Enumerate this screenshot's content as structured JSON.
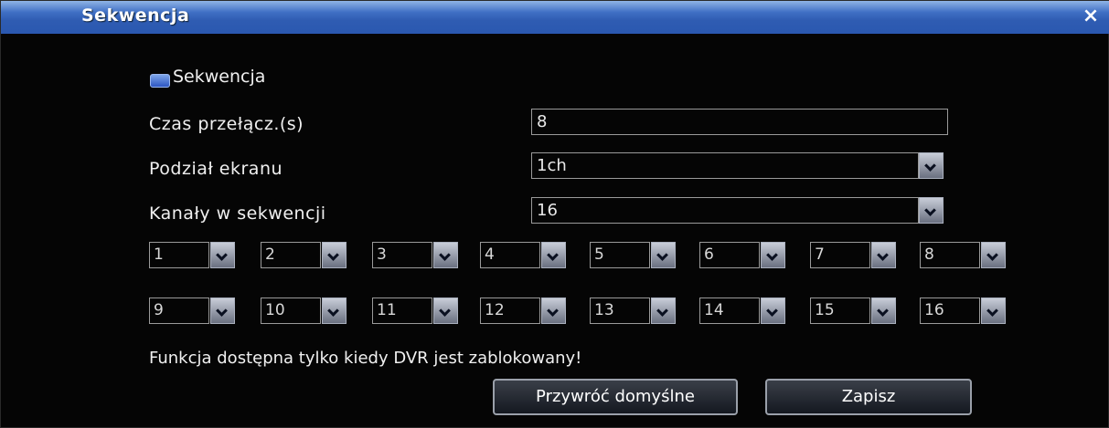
{
  "window": {
    "title": "Sekwencja",
    "close_glyph": "×"
  },
  "sequence_toggle": {
    "label": "Sekwencja",
    "checked": true
  },
  "fields": [
    {
      "label": "Czas przełącz.(s)",
      "value": "8"
    },
    {
      "label": "Podział ekranu",
      "value": "1ch"
    },
    {
      "label": "Kanały w sekwencji",
      "value": "16"
    }
  ],
  "channels_row1": [
    "1",
    "2",
    "3",
    "4",
    "5",
    "6",
    "7",
    "8"
  ],
  "channels_row2": [
    "9",
    "10",
    "11",
    "12",
    "13",
    "14",
    "15",
    "16"
  ],
  "notice": "Funkcja dostępna tylko kiedy DVR jest zablokowany!",
  "buttons": {
    "restore_defaults": "Przywróć domyślne",
    "save": "Zapisz"
  },
  "colors": {
    "title_bar": "#3f6fc4",
    "checkbox_fill": "#2d56c2",
    "background": "#050505"
  },
  "icons": {
    "close": "close-icon",
    "dropdown": "chevron-down-icon"
  }
}
